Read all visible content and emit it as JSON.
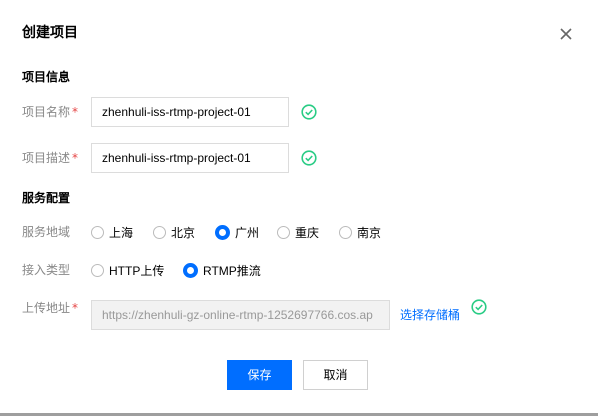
{
  "dialog": {
    "title": "创建项目"
  },
  "project_info": {
    "section_title": "项目信息",
    "name_label": "项目名称",
    "name_value": "zhenhuli-iss-rtmp-project-01",
    "desc_label": "项目描述",
    "desc_value": "zhenhuli-iss-rtmp-project-01",
    "required_mark": "*"
  },
  "service_config": {
    "section_title": "服务配置",
    "region_label": "服务地域",
    "regions": [
      {
        "label": "上海",
        "selected": false
      },
      {
        "label": "北京",
        "selected": false
      },
      {
        "label": "广州",
        "selected": true
      },
      {
        "label": "重庆",
        "selected": false
      },
      {
        "label": "南京",
        "selected": false
      }
    ],
    "access_label": "接入类型",
    "access_types": [
      {
        "label": "HTTP上传",
        "selected": false
      },
      {
        "label": "RTMP推流",
        "selected": true
      }
    ],
    "upload_label": "上传地址",
    "upload_value": "https://zhenhuli-gz-online-rtmp-1252697766.cos.ap",
    "select_bucket_link": "选择存储桶"
  },
  "footer": {
    "save_label": "保存",
    "cancel_label": "取消"
  },
  "colors": {
    "accent": "#006eff",
    "success": "#29cc85",
    "required": "#e54545"
  },
  "icons": {
    "close": "close-icon",
    "valid": "check-circle-icon"
  }
}
